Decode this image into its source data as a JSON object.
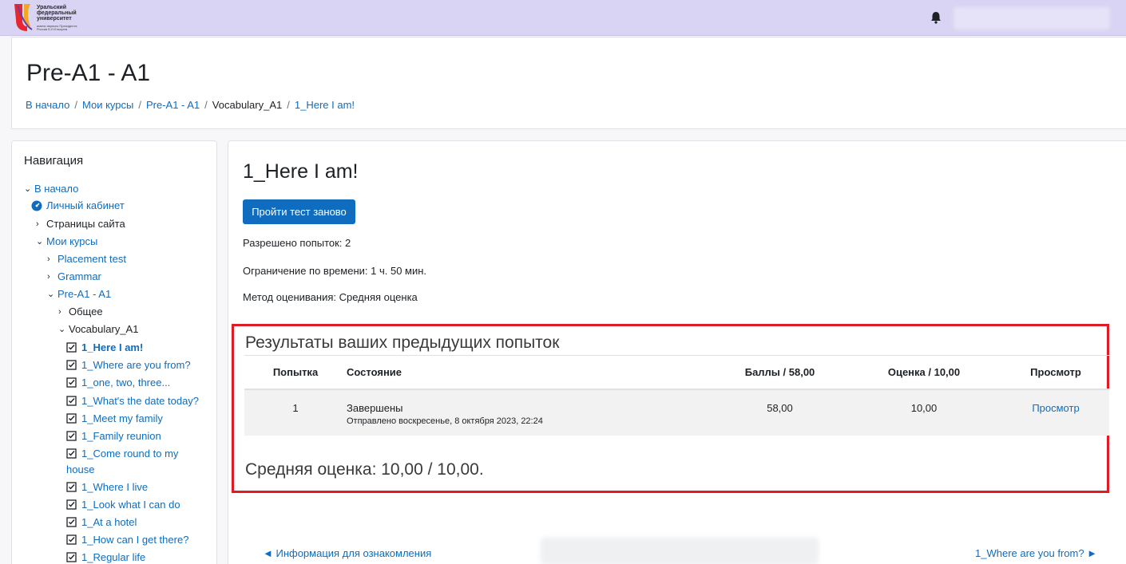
{
  "topbar": {
    "logo_lines": [
      "Уральский",
      "федеральный",
      "университет"
    ],
    "logo_sub": [
      "имени первого Президента",
      "России Б.Н.Ельцина"
    ],
    "bell_icon": "bell-icon",
    "accent": "#d9d4f4"
  },
  "header": {
    "title": "Pre-A1 - A1",
    "breadcrumb": [
      "В начало",
      "Мои курсы",
      "Pre-A1 - A1",
      "Vocabulary_A1",
      "1_Here I am!"
    ]
  },
  "nav": {
    "title": "Навигация",
    "items": [
      {
        "label": "В начало",
        "icon": "chevron-down-icon"
      },
      {
        "label": "Личный кабинет",
        "icon": "dashboard-icon"
      },
      {
        "label": "Страницы сайта",
        "icon": "chevron-right-icon"
      },
      {
        "label": "Мои курсы",
        "icon": "chevron-down-icon"
      },
      {
        "label": "Placement test",
        "icon": "chevron-right-icon"
      },
      {
        "label": "Grammar",
        "icon": "chevron-right-icon"
      },
      {
        "label": "Pre-A1 - A1",
        "icon": "chevron-down-icon"
      },
      {
        "label": "Общее",
        "icon": "chevron-right-icon"
      },
      {
        "label": "Vocabulary_A1",
        "icon": "chevron-down-icon"
      },
      {
        "label": "1_Here I am!",
        "icon": "checkbox-icon"
      },
      {
        "label": "1_Where are you from?",
        "icon": "checkbox-icon"
      },
      {
        "label": "1_one, two, three...",
        "icon": "checkbox-icon"
      },
      {
        "label": "1_What's the date today?",
        "icon": "checkbox-icon"
      },
      {
        "label": "1_Meet my family",
        "icon": "checkbox-icon"
      },
      {
        "label": "1_Family reunion",
        "icon": "checkbox-icon"
      },
      {
        "label": "1_Come round to my house",
        "icon": "checkbox-icon"
      },
      {
        "label": "1_Where I live",
        "icon": "checkbox-icon"
      },
      {
        "label": "1_Look what I can do",
        "icon": "checkbox-icon"
      },
      {
        "label": "1_At a hotel",
        "icon": "checkbox-icon"
      },
      {
        "label": "1_How can I get there?",
        "icon": "checkbox-icon"
      },
      {
        "label": "1_Regular life",
        "icon": "checkbox-icon"
      }
    ]
  },
  "main": {
    "title": "1_Here I am!",
    "retake_button": "Пройти тест заново",
    "attempts_allowed": "Разрешено попыток: 2",
    "time_limit": "Ограничение по времени: 1 ч. 50 мин.",
    "grading_method": "Метод оценивания: Средняя оценка",
    "results": {
      "heading": "Результаты ваших предыдущих попыток",
      "columns": [
        "Попытка",
        "Состояние",
        "Баллы / 58,00",
        "Оценка / 10,00",
        "Просмотр"
      ],
      "rows": [
        {
          "attempt": "1",
          "state": "Завершены",
          "submitted": "Отправлено воскресенье, 8 октября 2023, 22:24",
          "marks": "58,00",
          "grade": "10,00",
          "review": "Просмотр"
        }
      ],
      "average": "Средняя оценка: 10,00 / 10,00."
    },
    "prev_link": "◄ Информация для ознакомления",
    "next_link": "1_Where are you from? ►"
  }
}
